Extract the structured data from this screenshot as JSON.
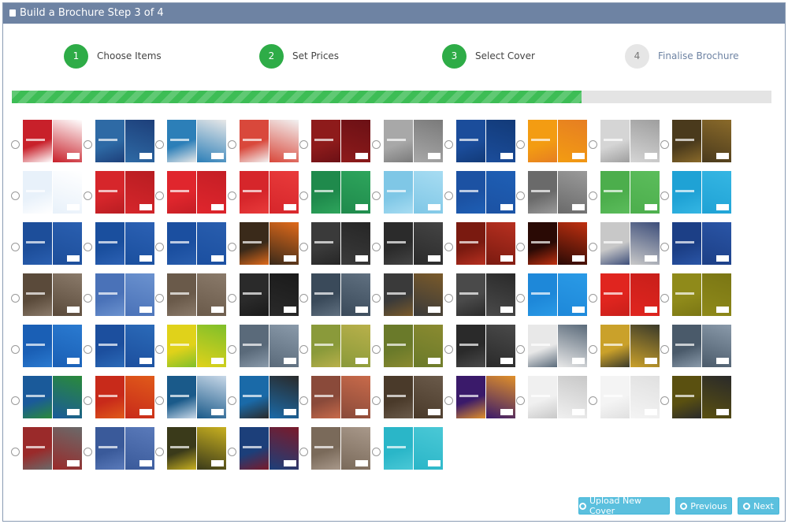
{
  "window": {
    "title": "Build a Brochure Step 3 of 4"
  },
  "steps": [
    {
      "number": "1",
      "label": "Choose Items",
      "state": "done"
    },
    {
      "number": "2",
      "label": "Set Prices",
      "state": "done"
    },
    {
      "number": "3",
      "label": "Select Cover",
      "state": "done"
    },
    {
      "number": "4",
      "label": "Finalise Brochure",
      "state": "todo"
    }
  ],
  "progress": {
    "percent": 75,
    "color": "#3dbd55"
  },
  "covers": [
    [
      "#c8202a",
      "#ffffff"
    ],
    [
      "#2e6aa5",
      "#1d3f7a"
    ],
    [
      "#2c7fb8",
      "#e8e8e8"
    ],
    [
      "#d9483b",
      "#f2f2f2"
    ],
    [
      "#8e1b1b",
      "#6b1015"
    ],
    [
      "#a8a8a8",
      "#7a7a7a"
    ],
    [
      "#1b4d9b",
      "#123a78"
    ],
    [
      "#f39c12",
      "#e67e22"
    ],
    [
      "#d5d5d5",
      "#9e9e9e"
    ],
    [
      "#4a3a1c",
      "#8a6a2a"
    ],
    [
      "#e8f1fa",
      "#ffffff"
    ],
    [
      "#d6262b",
      "#b81d22"
    ],
    [
      "#e0262d",
      "#c41e25"
    ],
    [
      "#d6262b",
      "#e93b3b"
    ],
    [
      "#1f8a4c",
      "#2ea55c"
    ],
    [
      "#7fc7e6",
      "#a7dcf2"
    ],
    [
      "#1c52a3",
      "#1e5fb5"
    ],
    [
      "#6a6a6a",
      "#9a9a9a"
    ],
    [
      "#4cae4c",
      "#5cbd5c"
    ],
    [
      "#1fa2d5",
      "#35b6e3"
    ],
    [
      "#1d4e9a",
      "#2a5fb0"
    ],
    [
      "#1a4f9e",
      "#2c61b4"
    ],
    [
      "#1b4fa0",
      "#295eae"
    ],
    [
      "#3a2a1a",
      "#e06a1a"
    ],
    [
      "#3a3a3a",
      "#262626"
    ],
    [
      "#2b2b2b",
      "#444444"
    ],
    [
      "#7a1a10",
      "#b83020"
    ],
    [
      "#2a0a05",
      "#c03010"
    ],
    [
      "#c8c8c8",
      "#3d4e7a"
    ],
    [
      "#1c3f86",
      "#2a55a6"
    ],
    [
      "#5a4a3a",
      "#8a7a6a"
    ],
    [
      "#4a72b8",
      "#6b92cf"
    ],
    [
      "#6a5a4a",
      "#8a7a6a"
    ],
    [
      "#2a2a2a",
      "#1a1a1a"
    ],
    [
      "#3a4a5a",
      "#607080"
    ],
    [
      "#3a3a3a",
      "#7a5a2a"
    ],
    [
      "#4a4a4a",
      "#2a2a2a"
    ],
    [
      "#1e88d9",
      "#2a9ae6"
    ],
    [
      "#e0251f",
      "#c81f1a"
    ],
    [
      "#8f8a1a",
      "#7a7614"
    ],
    [
      "#1a5fb5",
      "#2a7ad0"
    ],
    [
      "#1c4f9e",
      "#2b6ab8"
    ],
    [
      "#e0d21a",
      "#7fbf2a"
    ],
    [
      "#5a6a7a",
      "#8a9aaa"
    ],
    [
      "#8a9a3a",
      "#b8b04a"
    ],
    [
      "#6a7a2a",
      "#8a8a30"
    ],
    [
      "#2a2a2a",
      "#4a4a4a"
    ],
    [
      "#e8e8e8",
      "#5a6a7a"
    ],
    [
      "#caa12a",
      "#3a3a2a"
    ],
    [
      "#4a5a6a",
      "#8a9aaa"
    ],
    [
      "#1a5a9a",
      "#2a8a3a"
    ],
    [
      "#c82a1a",
      "#e05a1a"
    ],
    [
      "#1a5a8a",
      "#c8d8e8"
    ],
    [
      "#1a6aa8",
      "#2a2a2a"
    ],
    [
      "#8a4a3a",
      "#c86a4a"
    ],
    [
      "#4a3a2a",
      "#6a5a4a"
    ],
    [
      "#3a1a6a",
      "#e0902a"
    ],
    [
      "#f0f0f0",
      "#c8c8c8"
    ],
    [
      "#f4f4f4",
      "#e0e0e0"
    ],
    [
      "#5a5010",
      "#2a2a2a"
    ],
    [
      "#9a2a2a",
      "#6a6a6a"
    ],
    [
      "#3a5a9a",
      "#5a7aba"
    ],
    [
      "#3a3a1a",
      "#c8b020"
    ],
    [
      "#1c3f7a",
      "#7a1a2a"
    ],
    [
      "#7a6a5a",
      "#a8988a"
    ],
    [
      "#2ab6c8",
      "#4ac8d6"
    ]
  ],
  "buttons": {
    "upload": "Upload New Cover",
    "previous": "Previous",
    "next": "Next"
  }
}
